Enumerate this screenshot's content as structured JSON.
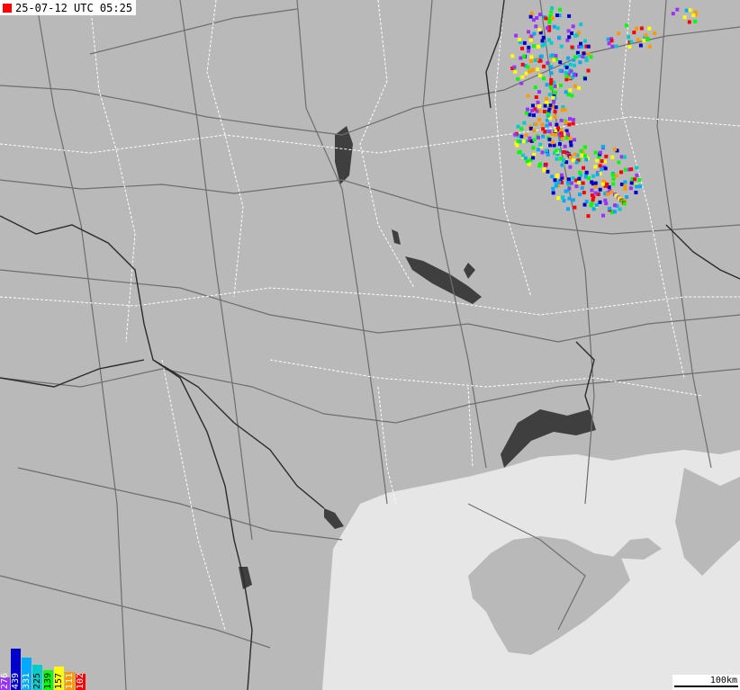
{
  "timestamp": "25-07-12 UTC 05:25",
  "scale": "100km",
  "colors": {
    "land": "#b9b9b9",
    "sea": "#e6e6e6",
    "water": "#3f3f3f",
    "roads": "#6e6e6e",
    "borders": "#ffffff",
    "country_border": "#2b2b2b",
    "marker": "#ff0000"
  },
  "legend": [
    {
      "value": "276",
      "color": "#9933ff"
    },
    {
      "value": "439",
      "color": "#0000cc"
    },
    {
      "value": "331",
      "color": "#00aaff"
    },
    {
      "value": "225",
      "color": "#00cccc"
    },
    {
      "value": "139",
      "color": "#00ff00"
    },
    {
      "value": "157",
      "color": "#ffff00"
    },
    {
      "value": "111",
      "color": "#ff9900"
    },
    {
      "value": "102",
      "color": "#ff0000"
    }
  ],
  "strikes_region": "lightning cluster north-east"
}
